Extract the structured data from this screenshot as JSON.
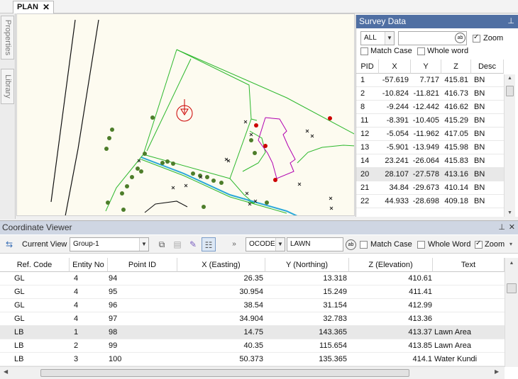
{
  "tabs": [
    {
      "label": "PLAN",
      "close": "✕"
    }
  ],
  "side_tabs": [
    "Properties",
    "Library"
  ],
  "survey": {
    "title": "Survey Data",
    "pin": "📌",
    "filter_value": "ALL",
    "search_value": "",
    "zoom_label": "Zoom",
    "zoom_checked": true,
    "match_case_label": "Match Case",
    "whole_word_label": "Whole word",
    "headers": [
      "PID",
      "X",
      "Y",
      "Z",
      "Desc"
    ],
    "rows": [
      {
        "pid": "1",
        "x": "-57.619",
        "y": "7.717",
        "z": "415.81",
        "desc": "BN"
      },
      {
        "pid": "2",
        "x": "-10.824",
        "y": "-11.821",
        "z": "416.73",
        "desc": "BN"
      },
      {
        "pid": "8",
        "x": "-9.244",
        "y": "-12.442",
        "z": "416.62",
        "desc": "BN"
      },
      {
        "pid": "11",
        "x": "-8.391",
        "y": "-10.405",
        "z": "415.29",
        "desc": "BN"
      },
      {
        "pid": "12",
        "x": "-5.054",
        "y": "-11.962",
        "z": "417.05",
        "desc": "BN"
      },
      {
        "pid": "13",
        "x": "-5.901",
        "y": "-13.949",
        "z": "415.98",
        "desc": "BN"
      },
      {
        "pid": "14",
        "x": "23.241",
        "y": "-26.064",
        "z": "415.83",
        "desc": "BN"
      },
      {
        "pid": "20",
        "x": "28.107",
        "y": "-27.578",
        "z": "413.16",
        "desc": "BN",
        "selected": true
      },
      {
        "pid": "21",
        "x": "34.84",
        "y": "-29.673",
        "z": "410.14",
        "desc": "BN"
      },
      {
        "pid": "22",
        "x": "44.933",
        "y": "-28.698",
        "z": "409.18",
        "desc": "BN"
      }
    ]
  },
  "coord_viewer": {
    "title": "Coordinate Viewer",
    "pin": "📌",
    "close": "✕",
    "current_view_label": "Current View",
    "current_view_value": "Group-1",
    "field_value": "OCODE",
    "search_value": "LAWN",
    "match_case_label": "Match Case",
    "whole_word_label": "Whole Word",
    "zoom_label": "Zoom",
    "zoom_checked": true,
    "headers": [
      "Ref. Code",
      "Entity No",
      "Point ID",
      "X (Easting)",
      "Y (Northing)",
      "Z (Elevation)",
      "Text"
    ],
    "rows": [
      {
        "ref": "GL",
        "entity": "4",
        "pid": "94",
        "x": "26.35",
        "y": "13.318",
        "z": "410.61",
        "text": ""
      },
      {
        "ref": "GL",
        "entity": "4",
        "pid": "95",
        "x": "30.954",
        "y": "15.249",
        "z": "411.41",
        "text": ""
      },
      {
        "ref": "GL",
        "entity": "4",
        "pid": "96",
        "x": "38.54",
        "y": "31.154",
        "z": "412.99",
        "text": ""
      },
      {
        "ref": "GL",
        "entity": "4",
        "pid": "97",
        "x": "34.904",
        "y": "32.783",
        "z": "413.36",
        "text": ""
      },
      {
        "ref": "LB",
        "entity": "1",
        "pid": "98",
        "x": "14.75",
        "y": "143.365",
        "z": "413.37",
        "text": "Lawn Area",
        "selected": true
      },
      {
        "ref": "LB",
        "entity": "2",
        "pid": "99",
        "x": "40.35",
        "y": "115.654",
        "z": "413.85",
        "text": "Lawn Area"
      },
      {
        "ref": "LB",
        "entity": "3",
        "pid": "100",
        "x": "50.373",
        "y": "135.365",
        "z": "414.1",
        "text": "Water Kundi"
      }
    ]
  },
  "colors": {
    "accent": "#4f6fa3",
    "plan_lines": "#2db82d",
    "building": "#b000b0",
    "marker": "#cc0000"
  }
}
